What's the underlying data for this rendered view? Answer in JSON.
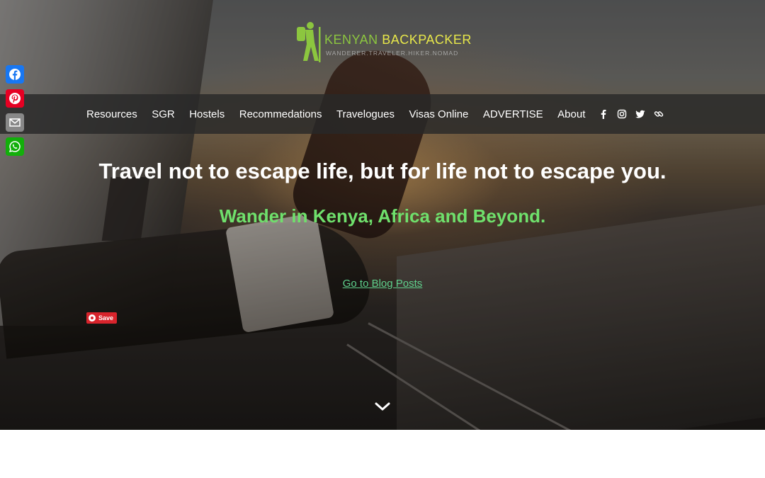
{
  "logo": {
    "kenyan": "KENYAN",
    "backpacker": " BACKPACKER",
    "tagline": "WANDERER.TRAVELER.HIKER.NOMAD"
  },
  "share": {
    "items": [
      {
        "name": "facebook-share-button",
        "icon": "facebook-icon",
        "color": "#1877f2"
      },
      {
        "name": "pinterest-share-button",
        "icon": "pinterest-icon",
        "color": "#e60023"
      },
      {
        "name": "email-share-button",
        "icon": "email-icon",
        "color": "#888888"
      },
      {
        "name": "whatsapp-share-button",
        "icon": "whatsapp-icon",
        "color": "#12af0a"
      }
    ]
  },
  "nav": {
    "items": [
      {
        "label": "Resources"
      },
      {
        "label": "SGR"
      },
      {
        "label": "Hostels"
      },
      {
        "label": "Recommedations"
      },
      {
        "label": "Travelogues"
      },
      {
        "label": "Visas Online"
      },
      {
        "label": "ADVERTISE"
      },
      {
        "label": "About"
      }
    ],
    "social_icons": [
      "facebook-icon",
      "instagram-icon",
      "twitter-icon",
      "link-icon"
    ]
  },
  "hero": {
    "headline": "Travel not to escape life, but for life not to escape you.",
    "subheadline": "Wander in Kenya, Africa and Beyond.",
    "blog_link": "Go to Blog Posts",
    "pin_save": "Save",
    "scroll_icon": "chevron-down-icon"
  },
  "colors": {
    "subheadline": "#6fe06c",
    "link": "#5fd08c",
    "logo_green": "#8cc63f",
    "logo_yellow": "#e8e84a",
    "nav_bar": "#282828",
    "pin_red": "#d8242c"
  }
}
